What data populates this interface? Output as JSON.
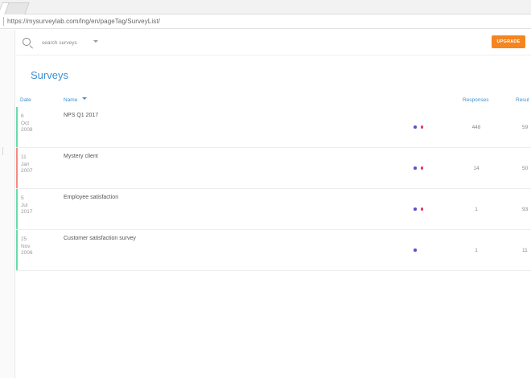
{
  "browser": {
    "url": "https://mysurveylab.com/lng/en/pageTag/SurveyList/"
  },
  "toolbar": {
    "search_placeholder": "search surveys",
    "upgrade_label": "UPGRADE",
    "upgrade_color": "#f5851f"
  },
  "page": {
    "title": "Surveys"
  },
  "table": {
    "columns": {
      "date": "Date",
      "name": "Name",
      "responses": "Responses",
      "results": "Resul"
    },
    "rows": [
      {
        "day": "6",
        "month": "Oct",
        "year": "2008",
        "name": "NPS Q1 2017",
        "responses": "448",
        "results": "59",
        "bar_color": "#66ddaa",
        "dots": [
          "#5b4fcf",
          "#e8336d"
        ]
      },
      {
        "day": "11",
        "month": "Jan",
        "year": "2007",
        "name": "Mystery client",
        "responses": "14",
        "results": "50",
        "bar_color": "#f28b82",
        "dots": [
          "#5b4fcf",
          "#e8336d"
        ]
      },
      {
        "day": "5",
        "month": "Jul",
        "year": "2017",
        "name": "Employee satisfaction",
        "responses": "1",
        "results": "93",
        "bar_color": "#66ddaa",
        "dots": [
          "#5b4fcf",
          "#e8336d"
        ]
      },
      {
        "day": "25",
        "month": "Nov",
        "year": "2006",
        "name": "Customer satisfaction survey",
        "responses": "1",
        "results": "11",
        "bar_color": "#66ddaa",
        "dots": [
          "#5b4fcf"
        ]
      }
    ]
  }
}
